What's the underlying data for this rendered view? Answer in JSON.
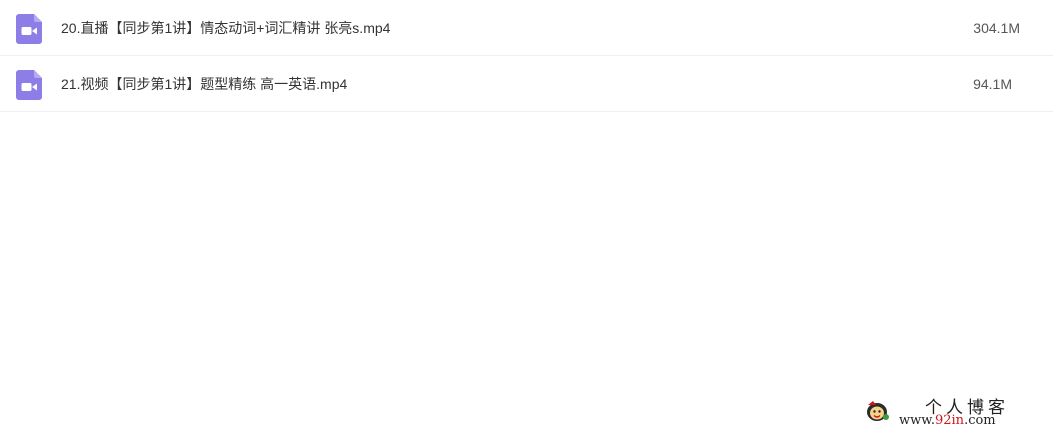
{
  "files": [
    {
      "icon": "video-file-icon",
      "name": "20.直播【同步第1讲】情态动词+词汇精讲 张亮s.mp4",
      "size": "304.1M"
    },
    {
      "icon": "video-file-icon",
      "name": "21.视频【同步第1讲】题型精练 高一英语.mp4",
      "size": "94.1M"
    }
  ],
  "colors": {
    "icon_purple": "#8c7ee6",
    "divider": "#f0f0f2",
    "watermark_accent": "#d0141c"
  },
  "watermark": {
    "title": "个人博客",
    "url_prefix": "www.",
    "url_accent": "92in",
    "url_suffix": ".com"
  }
}
